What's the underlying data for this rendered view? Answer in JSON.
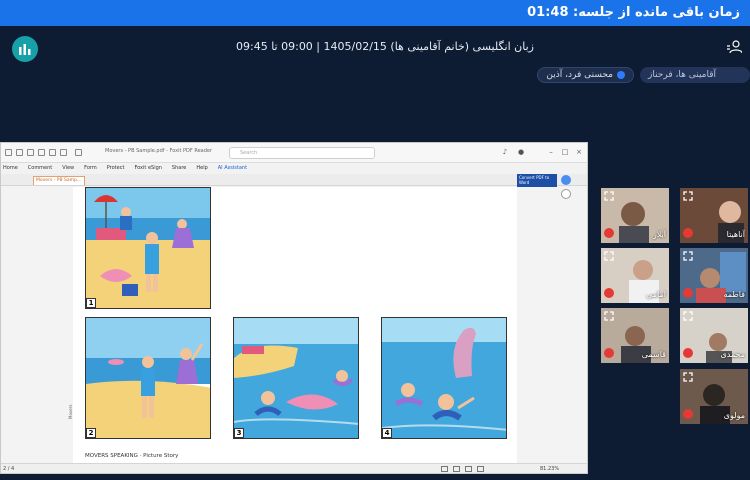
{
  "banner": {
    "timer_text": "زمان باقی مانده از جلسه: 01:48"
  },
  "session": {
    "info": "زبان انگلیسی (خانم آقامینی ها) 1405/02/15 | 09:00 تا 09:45"
  },
  "participants_bar": {
    "speaker": "محسنی فرد، آذین",
    "host": "آقامینی ها، فرحناز"
  },
  "shared_screen": {
    "window_title": "Movers - PB Sample.pdf - Foxit PDF Reader",
    "search_placeholder": "Search",
    "menu": [
      "Home",
      "Comment",
      "View",
      "Form",
      "Protect",
      "Foxit eSign",
      "Share",
      "Help",
      "AI Assistant"
    ],
    "tab_label": "Movers - PB Samp...",
    "convert_label": "Convert PDF to Word",
    "page_indicator": "2 / 4",
    "zoom": "81.23%",
    "side_label": "Movers",
    "footer_text": "MOVERS SPEAKING · Picture Story",
    "pictures": [
      {
        "number": "1"
      },
      {
        "number": "2"
      },
      {
        "number": "3"
      },
      {
        "number": "4"
      }
    ]
  },
  "video_tiles": [
    {
      "name": "آیلار"
    },
    {
      "name": "آناهیتا"
    },
    {
      "name": "امامی"
    },
    {
      "name": "فاطمه"
    },
    {
      "name": "قاسمی"
    },
    {
      "name": "محمدی"
    },
    {
      "name": "مولوی"
    }
  ],
  "colors": {
    "background": "#0d1b33",
    "banner": "#1a73e8",
    "mute": "#e53935",
    "logo": "#18a0a8"
  }
}
